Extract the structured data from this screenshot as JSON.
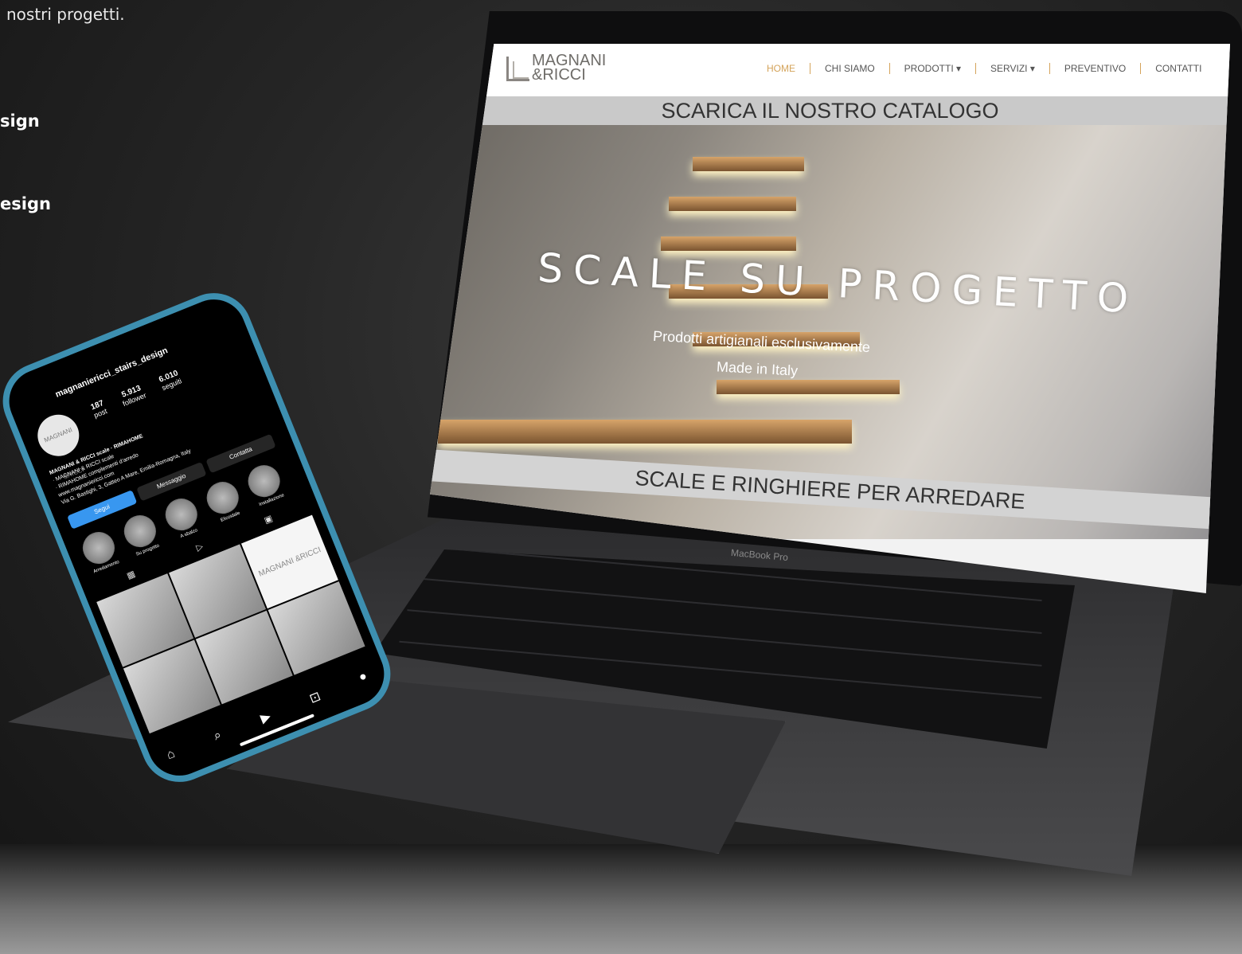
{
  "left_copy": {
    "intro": "nostri progetti.",
    "label_1": "sign",
    "label_2": "esign"
  },
  "website": {
    "logo_line1": "MAGNANI",
    "logo_line2": "&RICCI",
    "menu": [
      "HOME",
      "CHI SIAMO",
      "PRODOTTI ▾",
      "SERVIZI ▾",
      "PREVENTIVO",
      "CONTATTI"
    ],
    "active_menu": "HOME",
    "catalog_banner": "SCARICA IL NOSTRO CATALOGO",
    "hero_title": "SCALE SU PROGETTO",
    "hero_sub_1": "Prodotti artigianali esclusivamente",
    "hero_sub_2": "Made in Italy",
    "bottom_banner": "SCALE E RINGHIERE PER ARREDARE",
    "accent_color": "#d4a35a"
  },
  "laptop": {
    "model_label": "MacBook Pro"
  },
  "instagram": {
    "username": "magnaniericci_stairs_design",
    "avatar_text": "MAGNANI &RICCI",
    "stats": [
      {
        "value": "187",
        "label": "post"
      },
      {
        "value": "5.913",
        "label": "follower"
      },
      {
        "value": "6.010",
        "label": "seguiti"
      }
    ],
    "bio_name": "MAGNANI & RICCI scale · RIMAHOME",
    "bio_lines": [
      "· MAGNANI & RICCI scale",
      "· RIMAHOME complementi d'arredo",
      "www.magnaniericci.com",
      "Via G. Bastighi, 3, Gatteo A Mare, Emilia-Romagna, Italy"
    ],
    "buttons": [
      "Segui",
      "Messaggio",
      "Contatta"
    ],
    "highlights": [
      "Arredamento",
      "Su progetto",
      "A sbalzo",
      "Elicoidale",
      "Installazione"
    ],
    "grid_logo_text": "MAGNANI &RICCI",
    "tab_icons": [
      "grid-icon",
      "reels-icon",
      "tagged-icon"
    ],
    "nav_icons": [
      "home-icon",
      "search-icon",
      "reels-icon",
      "shop-icon",
      "profile-icon"
    ]
  }
}
